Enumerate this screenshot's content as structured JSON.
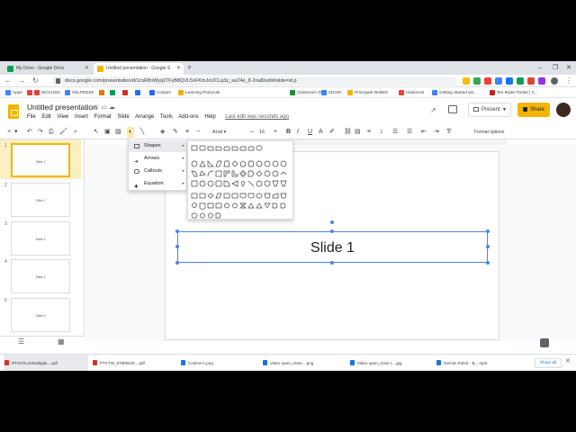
{
  "browser": {
    "tabs": [
      {
        "title": "My Drive - Google Drive",
        "favicon_color": "#0f9d58"
      },
      {
        "title": "Untitled presentation - Google S",
        "favicon_color": "#f4b400"
      }
    ],
    "url": "docs.google.com/presentation/d/1csR8nWyq27FyB8QVL5xFKmJoUCLq3z_seZ4e_8-2na8/edit#slide=id.p",
    "bookmarks": [
      {
        "label": "Apps",
        "color": "#4285f4"
      },
      {
        "label": "",
        "color": "#ea4335"
      },
      {
        "label": "WCCUSD",
        "color": "#db4437"
      },
      {
        "label": "HELPDESK",
        "color": "#4285f4"
      },
      {
        "label": "",
        "color": "#e37400"
      },
      {
        "label": "",
        "color": "#0f9d58"
      },
      {
        "label": "",
        "color": "#d93025"
      },
      {
        "label": "",
        "color": "#1a73e8"
      },
      {
        "label": "Coolors",
        "color": "#2962ff"
      },
      {
        "label": "Learning Protocols",
        "color": "#f9ab00"
      },
      {
        "label": "Classroom Te",
        "color": "#1e8e3e"
      },
      {
        "label": "ZOOM",
        "color": "#2d8cff"
      },
      {
        "label": "Principals' Bulletin",
        "color": "#f4b400"
      },
      {
        "label": "Absences",
        "color": "#ea4335"
      },
      {
        "label": "Getting Started wit...",
        "color": "#4285f4"
      },
      {
        "label": "Ten Rules Poster | C...",
        "color": "#c5221f"
      }
    ]
  },
  "app": {
    "title": "Untitled presentation",
    "menus": [
      "File",
      "Edit",
      "View",
      "Insert",
      "Format",
      "Slide",
      "Arrange",
      "Tools",
      "Add-ons",
      "Help"
    ],
    "last_edit": "Last edit was seconds ago",
    "present_label": "Present",
    "share_label": "Share"
  },
  "toolbar": {
    "font": "Arial",
    "font_size": "16",
    "format_options": "Format options"
  },
  "filmstrip": {
    "slides": [
      {
        "num": "1",
        "label": "Slide 1"
      },
      {
        "num": "2",
        "label": "Slide 2"
      },
      {
        "num": "3",
        "label": "Slide 3"
      },
      {
        "num": "4",
        "label": "Slide 4"
      },
      {
        "num": "5",
        "label": "Slide 5"
      }
    ]
  },
  "canvas": {
    "slide_title": "Slide 1"
  },
  "insert_menu": {
    "items": [
      "Shapes",
      "Arrows",
      "Callouts",
      "Equation"
    ],
    "highlighted": "Shapes"
  },
  "downloads": {
    "items": [
      {
        "name": "RTSVOL34N2digita....pdf",
        "icon_color": "#d93025"
      },
      {
        "name": "PTCTW_97809429....pdf",
        "icon_color": "#d93025"
      },
      {
        "name": "Control-A.png",
        "icon_color": "#1a73e8"
      },
      {
        "name": "Video open_close....png",
        "icon_color": "#1a73e8"
      },
      {
        "name": "Video open_close (....jpg",
        "icon_color": "#1a73e8"
      },
      {
        "name": "Gemini Robot - B....mp3",
        "icon_color": "#1a73e8"
      }
    ],
    "show_all": "Show all"
  }
}
